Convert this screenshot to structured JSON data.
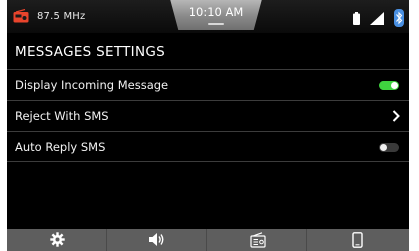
{
  "status": {
    "frequency": "87.5 MHz",
    "time": "10:10 AM",
    "icons": [
      "radio-icon",
      "battery-icon",
      "signal-icon",
      "bluetooth-icon"
    ]
  },
  "colors": {
    "accent_radio": "#e8442c",
    "toggle_on": "#3fd13f",
    "bluetooth": "#4a90e2"
  },
  "title": "MESSAGES SETTINGS",
  "settings": [
    {
      "label": "Display Incoming Message",
      "control": "toggle",
      "state": "on"
    },
    {
      "label": "Reject With SMS",
      "control": "chevron-right-icon"
    },
    {
      "label": "Auto Reply SMS",
      "control": "toggle",
      "state": "off"
    }
  ],
  "nav": [
    "settings-gear-icon",
    "volume-icon",
    "radio-tuner-icon",
    "phone-icon"
  ]
}
